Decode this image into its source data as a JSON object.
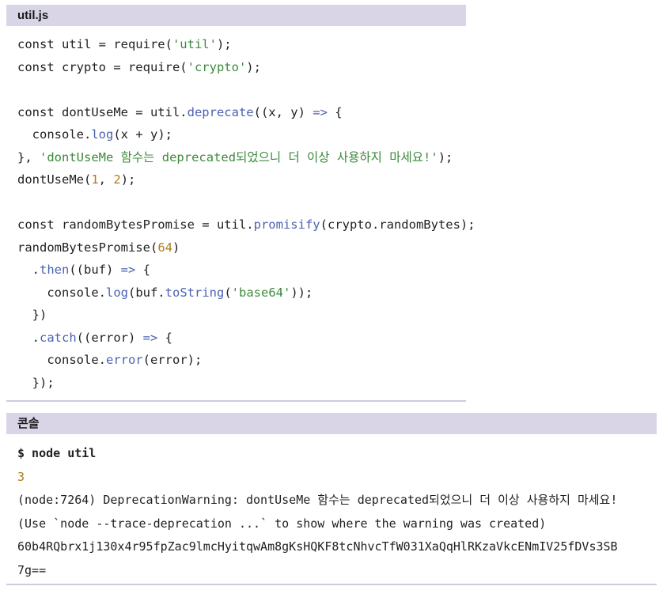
{
  "code_panel": {
    "filename": "util.js",
    "lines": [
      "const util = require('util');",
      "const crypto = require('crypto');",
      "",
      "const dontUseMe = util.deprecate((x, y) => {",
      "  console.log(x + y);",
      "}, 'dontUseMe 함수는 deprecated되었으니 더 이상 사용하지 마세요!');",
      "dontUseMe(1, 2);",
      "",
      "const randomBytesPromise = util.promisify(crypto.randomBytes);",
      "randomBytesPromise(64)",
      "  .then((buf) => {",
      "    console.log(buf.toString('base64'));",
      "  })",
      "  .catch((error) => {",
      "    console.error(error);",
      "  });"
    ]
  },
  "console_panel": {
    "title": "콘솔",
    "command": "$ node util",
    "output": [
      "3",
      "(node:7264) DeprecationWarning: dontUseMe 함수는 deprecated되었으니 더 이상 사용하지 마세요!",
      "(Use `node --trace-deprecation ...` to show where the warning was created)",
      "60b4RQbrx1j130x4r95fpZac9lmcHyitqwAm8gKsHQKF8tcNhvcTfW031XaQqHlRKzaVkcENmIV25fDVs3SB",
      "7g=="
    ]
  },
  "colors": {
    "header_bg": "#d9d5e6",
    "function": "#4a62b3",
    "string": "#3c8a3c",
    "number": "#b07a1b"
  }
}
